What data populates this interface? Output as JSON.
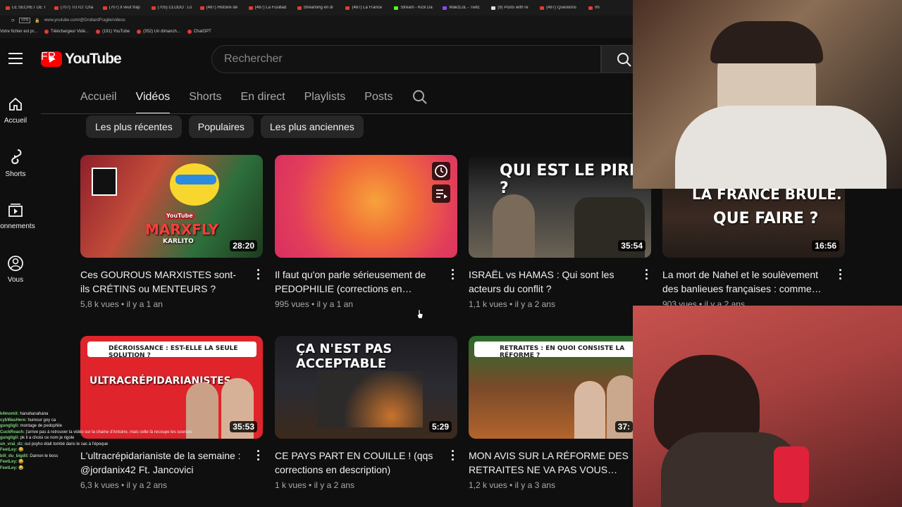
{
  "browser": {
    "tabs": [
      "LE SECRET DE T",
      "(707) TUTO: Cha",
      "(707) Il veut frap",
      "(705) CLODO : Lo",
      "(487) Histoire de",
      "(487) La Fusillad",
      "Streaming en di",
      "(487) La France",
      "Stream - Kick Da",
      "WakzLoL - Twitc",
      "(9) Posts with re",
      "(487) Questions",
      "Im"
    ],
    "url": "www.youtube.com/@DroitardFragile/videos",
    "vpn_label": "VPN",
    "bookmarks": [
      "Votre fichier est pr...",
      "Téléchargeur Vidé...",
      "(191) YouTube",
      "(352) Un dimanch...",
      "ChatGPT"
    ]
  },
  "header": {
    "logo_text": "YouTube",
    "region": "FR",
    "search_placeholder": "Rechercher"
  },
  "rail": [
    {
      "label": "Accueil",
      "icon": "home-icon"
    },
    {
      "label": "Shorts",
      "icon": "shorts-icon"
    },
    {
      "label": "Abonnements",
      "icon": "subscriptions-icon"
    },
    {
      "label": "Vous",
      "icon": "you-icon"
    }
  ],
  "channel_tabs": [
    "Accueil",
    "Vidéos",
    "Shorts",
    "En direct",
    "Playlists",
    "Posts"
  ],
  "active_tab": "Vidéos",
  "chips": [
    "Les plus récentes",
    "Populaires",
    "Les plus anciennes"
  ],
  "videos": [
    {
      "title": "Ces GOUROUS MARXISTES sont-ils CRÉTINS ou MENTEURS ?",
      "duration": "28:20",
      "views": "5,8 k vues",
      "age": "il y a 1 an",
      "overlay": "MARXFLY",
      "overlay2": "KARLITO",
      "overlay3": "YouTube"
    },
    {
      "title": "Il faut qu'on parle sérieusement de PEDOPHILIE (corrections en…",
      "duration": "",
      "views": "995 vues",
      "age": "il y a 1 an"
    },
    {
      "title": "ISRAËL vs HAMAS : Qui sont les acteurs du conflit ?",
      "duration": "35:54",
      "views": "1,1 k vues",
      "age": "il y a 2 ans",
      "overlay": "QUI EST LE PIRE ?"
    },
    {
      "title": "La mort de Nahel et le soulèvement des banlieues françaises : comme…",
      "duration": "16:56",
      "views": "903 vues",
      "age": "il y a 2 ans",
      "overlay": "LA FRANCE BRULE.",
      "overlay2": "QUE FAIRE ?"
    },
    {
      "title": "L'ultracrépidarianiste de la semaine : @jordanix42 Ft. Jancovici",
      "duration": "35:53",
      "views": "6,3 k vues",
      "age": "il y a 2 ans",
      "overlay": "DÉCROISSANCE : EST-ELLE LA SEULE SOLUTION ?",
      "overlay2": "ULTRACRÉPIDARIANISTES"
    },
    {
      "title": "CE PAYS PART EN COUILLE ! (qqs corrections en description)",
      "duration": "5:29",
      "views": "1 k vues",
      "age": "il y a 2 ans",
      "overlay": "ÇA N'EST PAS ACCEPTABLE"
    },
    {
      "title": "MON AVIS SUR LA RÉFORME DES RETRAITES NE VA PAS VOUS…",
      "duration": "37:",
      "views": "1,2 k vues",
      "age": "il y a 3 ans",
      "overlay": "RETRAITES : EN QUOI CONSISTE LA RÉFORME ?"
    }
  ],
  "meta_sep": " • ",
  "chat": [
    {
      "user": "k4momit:",
      "msg": "hanahanahana"
    },
    {
      "user": "cybWasHere:",
      "msg": "humour goy ca"
    },
    {
      "user": "gungligli:",
      "msg": "montage de pedophile"
    },
    {
      "user": "CuckRoach:",
      "msg": "j'arrive pas à retrouver la vidéo sur la chaine d'Antoine, mais celle là recoupe les sources"
    },
    {
      "user": "gungligli:",
      "msg": "pk il a choisi ce nom je rigole"
    },
    {
      "user": "un_vrai_dz:",
      "msg": "oui psyho était tombé dans le sac à l'époque"
    },
    {
      "user": "FeetLey:",
      "msg": "😂"
    },
    {
      "user": "bill_du_bigdil:",
      "msg": "Damon le boss"
    },
    {
      "user": "FeetLey:",
      "msg": "😂"
    },
    {
      "user": "FeetLey:",
      "msg": "😂"
    }
  ]
}
